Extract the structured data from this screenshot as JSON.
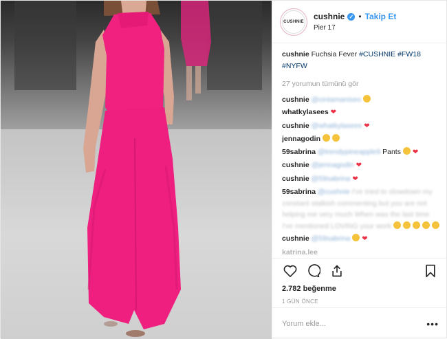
{
  "header": {
    "avatar_text": "CUSHNIE",
    "username": "cushnie",
    "verified_icon": "verified-check-icon",
    "follow_label": "Takip Et",
    "location": "Pier 17"
  },
  "caption": {
    "user": "cushnie",
    "text": "Fuchsia Fever",
    "tags": [
      "#CUSHNIE",
      "#FW18",
      "#NYFW"
    ]
  },
  "view_all_comments": "27 yorumun tümünü gör",
  "comments": [
    {
      "user": "cushnie",
      "mention": "@cintamaniseo",
      "text": "",
      "emoji": [
        "smile"
      ]
    },
    {
      "user": "whatkylasees",
      "mention": "",
      "text": "",
      "emoji": [
        "heart"
      ]
    },
    {
      "user": "cushnie",
      "mention": "@whatkylasees",
      "text": "",
      "emoji": [
        "heart"
      ]
    },
    {
      "user": "jennagodin",
      "mention": "",
      "text": "",
      "emoji": [
        "smile",
        "smile"
      ]
    },
    {
      "user": "59sabrina",
      "mention": "@trendypineapple9",
      "text": "Pants",
      "emoji": [
        "smile",
        "heart"
      ]
    },
    {
      "user": "cushnie",
      "mention": "@jennagodin",
      "text": "",
      "emoji": [
        "heart"
      ]
    },
    {
      "user": "cushnie",
      "mention": "@59sabrina",
      "text": "",
      "emoji": [
        "heart"
      ]
    },
    {
      "user": "59sabrina",
      "mention": "@cushnie",
      "text": "I've tried to slowdown my constant stalkish commenting but you are not helping me very much When was the last time I've mentioned LOVING your work",
      "emoji": [
        "smile",
        "smile",
        "smile",
        "smile",
        "smile"
      ]
    },
    {
      "user": "cushnie",
      "mention": "@59sabrina",
      "text": "",
      "emoji": [
        "smile",
        "heart"
      ]
    },
    {
      "user": "katrina.lee",
      "mention": "",
      "text": "",
      "emoji": []
    }
  ],
  "actions": {
    "like_icon": "heart-outline-icon",
    "comment_icon": "comment-bubble-icon",
    "share_icon": "share-icon",
    "save_icon": "bookmark-icon"
  },
  "likes_text": "2.782 beğenme",
  "time_text": "1 GÜN ÖNCE",
  "add_comment": {
    "placeholder": "Yorum ekle...",
    "more_label": "•••"
  },
  "colors": {
    "accent": "#3897f0",
    "dress": "#f0217f",
    "heart": "#ed3045"
  }
}
